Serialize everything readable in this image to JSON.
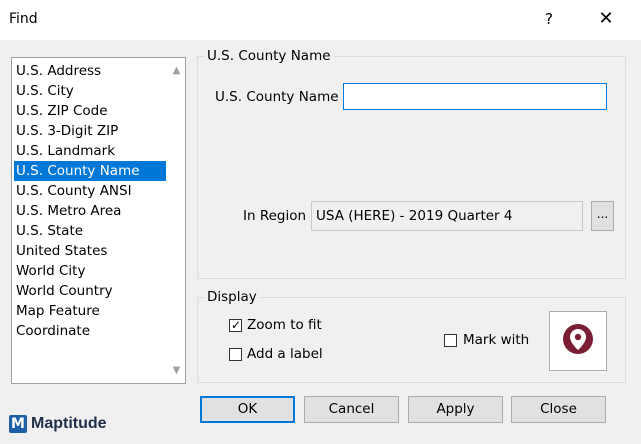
{
  "window": {
    "title": "Find",
    "help": "?",
    "close": "✕"
  },
  "list": {
    "items": [
      {
        "label": "U.S. Address",
        "selected": false
      },
      {
        "label": "U.S. City",
        "selected": false
      },
      {
        "label": "U.S. ZIP Code",
        "selected": false
      },
      {
        "label": "U.S. 3-Digit ZIP",
        "selected": false
      },
      {
        "label": "U.S. Landmark",
        "selected": false
      },
      {
        "label": "U.S. County Name",
        "selected": true
      },
      {
        "label": "U.S. County ANSI",
        "selected": false
      },
      {
        "label": "U.S. Metro Area",
        "selected": false
      },
      {
        "label": "U.S. State",
        "selected": false
      },
      {
        "label": "United States",
        "selected": false
      },
      {
        "label": "World City",
        "selected": false
      },
      {
        "label": "World Country",
        "selected": false
      },
      {
        "label": "Map Feature",
        "selected": false
      },
      {
        "label": "Coordinate",
        "selected": false
      }
    ]
  },
  "search": {
    "group_label": "U.S. County Name",
    "field_label": "U.S. County Name",
    "field_value": "",
    "region_label": "In Region",
    "region_value": "USA (HERE) - 2019 Quarter 4",
    "browse_label": "..."
  },
  "display": {
    "group_label": "Display",
    "zoom_to_fit": {
      "label": "Zoom to fit",
      "checked": true
    },
    "add_label": {
      "label": "Add a label",
      "checked": false
    },
    "mark_with": {
      "label": "Mark with",
      "checked": false
    },
    "marker_icon": "map-pin-icon",
    "marker_color": "#7a1f33"
  },
  "buttons": {
    "ok": "OK",
    "cancel": "Cancel",
    "apply": "Apply",
    "close": "Close"
  },
  "brand": {
    "name": "Maptitude",
    "mark": "M",
    "color": "#1e5fa8"
  },
  "colors": {
    "selection": "#0078d7",
    "focus_border": "#0078d7"
  }
}
